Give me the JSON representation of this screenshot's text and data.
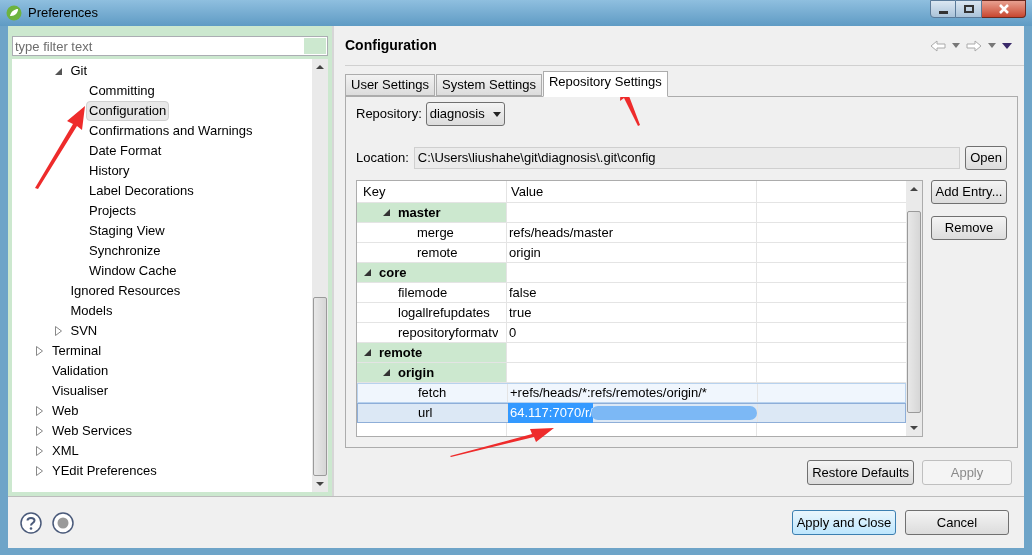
{
  "window": {
    "title": "Preferences"
  },
  "filter": {
    "placeholder": "type filter text"
  },
  "tree": [
    {
      "kind": "continued",
      "children": [
        {
          "label": "Git",
          "expandable": true,
          "expanded": true,
          "selected": false,
          "children": [
            {
              "label": "Committing",
              "selected": false
            },
            {
              "label": "Configuration",
              "selected": true
            },
            {
              "label": "Confirmations and Warnings",
              "selected": false
            },
            {
              "label": "Date Format",
              "selected": false
            },
            {
              "label": "History",
              "selected": false
            },
            {
              "label": "Label Decorations",
              "selected": false
            },
            {
              "label": "Projects",
              "selected": false
            },
            {
              "label": "Staging View",
              "selected": false
            },
            {
              "label": "Synchronize",
              "selected": false
            },
            {
              "label": "Window Cache",
              "selected": false
            }
          ]
        },
        {
          "label": "Ignored Resources",
          "selected": false
        },
        {
          "label": "Models",
          "selected": false
        },
        {
          "label": "SVN",
          "expandable": true,
          "expanded": false,
          "selected": false
        }
      ]
    },
    {
      "label": "Terminal",
      "expandable": true,
      "expanded": false,
      "selected": false
    },
    {
      "label": "Validation",
      "selected": false
    },
    {
      "label": "Visualiser",
      "selected": false
    },
    {
      "label": "Web",
      "expandable": true,
      "expanded": false,
      "selected": false
    },
    {
      "label": "Web Services",
      "expandable": true,
      "expanded": false,
      "selected": false
    },
    {
      "label": "XML",
      "expandable": true,
      "expanded": false,
      "selected": false
    },
    {
      "label": "YEdit Preferences",
      "expandable": true,
      "expanded": false,
      "selected": false
    }
  ],
  "page": {
    "title": "Configuration"
  },
  "tabs": [
    {
      "label": "User Settings",
      "selected": false
    },
    {
      "label": "System Settings",
      "selected": false
    },
    {
      "label": "Repository Settings",
      "selected": true
    }
  ],
  "repository": {
    "label": "Repository:",
    "value": "diagnosis"
  },
  "location": {
    "label": "Location:",
    "value": "C:\\Users\\liushahe\\git\\diagnosis\\.git\\config",
    "button": "Open"
  },
  "table": {
    "columns": [
      "Key",
      "Value"
    ],
    "rows": [
      {
        "kind": "continued",
        "children": [
          {
            "kind": "section",
            "key": "master",
            "expanded": true,
            "children": [
              {
                "kind": "entry",
                "key": "merge",
                "value": "refs/heads/master",
                "selected": false,
                "hovered": false
              },
              {
                "kind": "entry",
                "key": "remote",
                "value": "origin",
                "selected": false,
                "hovered": false
              }
            ]
          }
        ]
      },
      {
        "kind": "section",
        "key": "core",
        "expanded": true,
        "children": [
          {
            "kind": "entry",
            "key": "filemode",
            "value": "false",
            "selected": false,
            "hovered": false
          },
          {
            "kind": "entry",
            "key": "logallrefupdates",
            "value": "true",
            "selected": false,
            "hovered": false
          },
          {
            "kind": "entry",
            "key": "repositoryformatv",
            "value": "0",
            "selected": false,
            "hovered": false
          }
        ]
      },
      {
        "kind": "section",
        "key": "remote",
        "expanded": true,
        "children": [
          {
            "kind": "section",
            "key": "origin",
            "expanded": true,
            "children": [
              {
                "kind": "entry",
                "key": "fetch",
                "value": "+refs/heads/*:refs/remotes/origin/*",
                "selected": false,
                "hovered": true
              },
              {
                "kind": "entry",
                "key": "url",
                "value": "64.117:7070/r/",
                "selected": true,
                "hovered": false,
                "redacted": true
              }
            ]
          }
        ]
      }
    ]
  },
  "side_buttons": [
    "Add Entry...",
    "Remove"
  ],
  "page_buttons": [
    {
      "label": "Restore Defaults",
      "disabled": false
    },
    {
      "label": "Apply",
      "disabled": true
    }
  ],
  "dialog_buttons": [
    {
      "label": "Apply and Close",
      "default": true
    },
    {
      "label": "Cancel",
      "default": false
    }
  ]
}
